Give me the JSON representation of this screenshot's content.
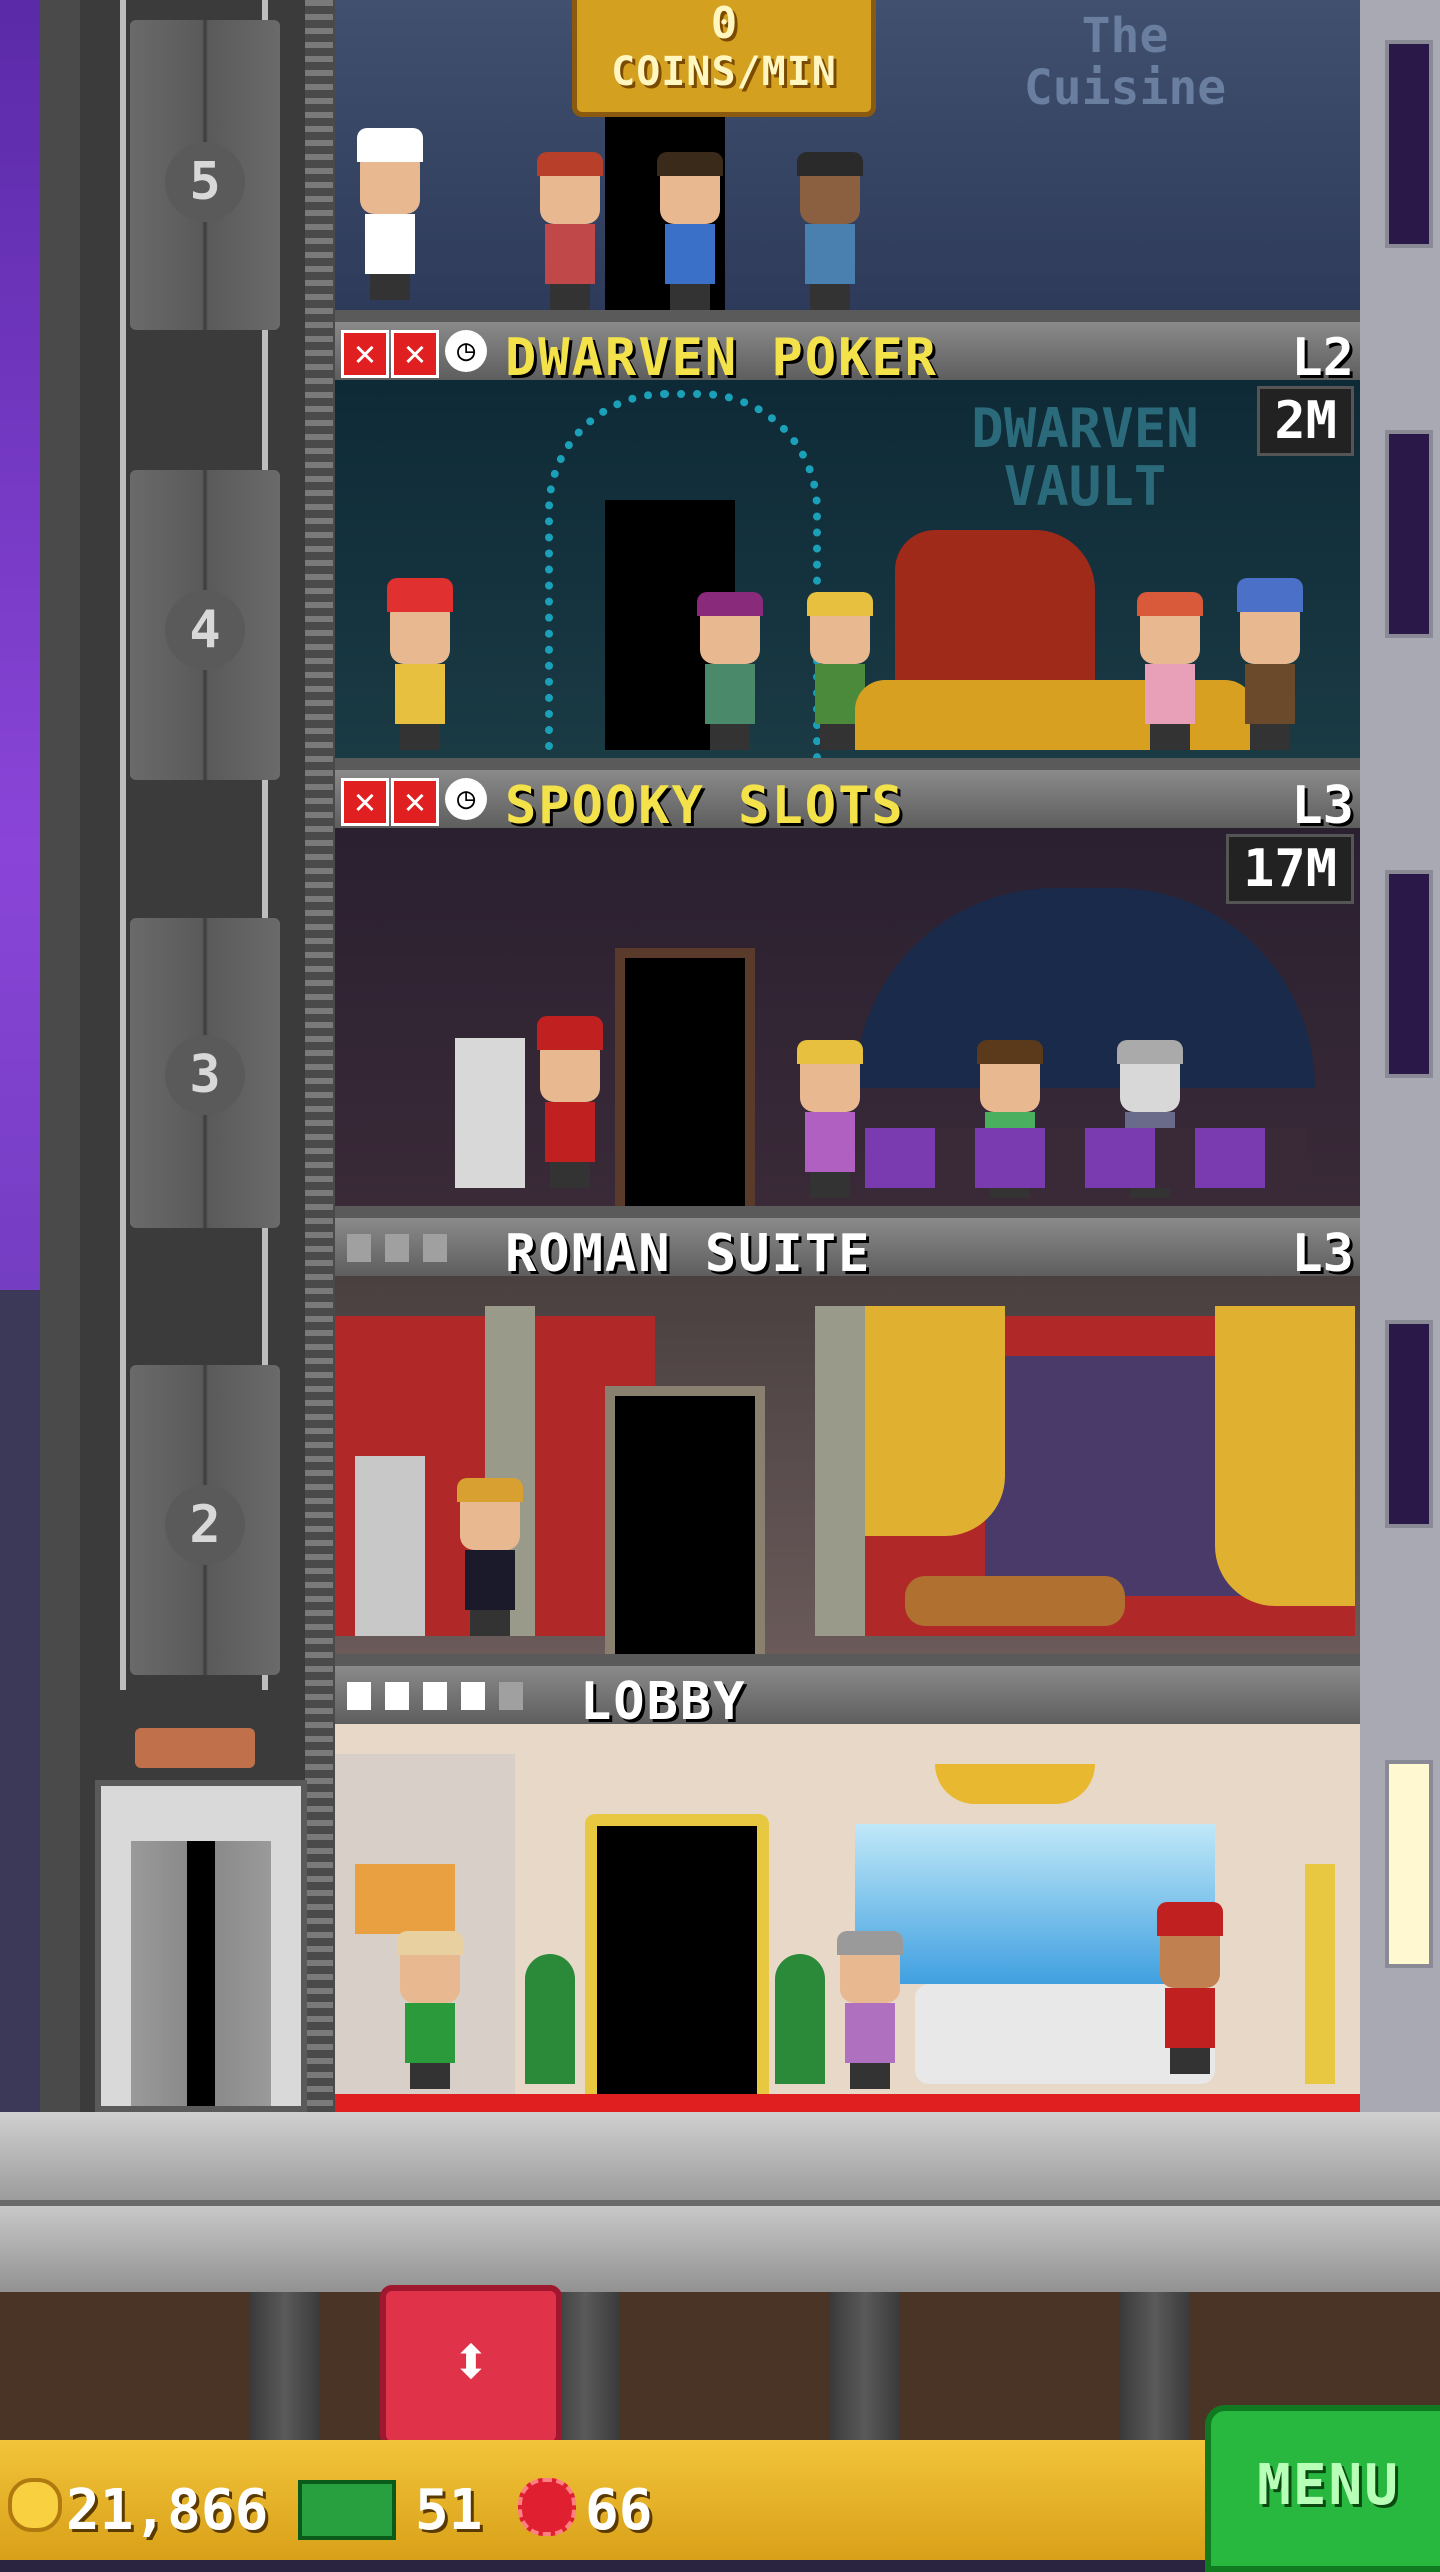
{
  "top": {
    "coins_per_min_value": "0",
    "coins_per_min_label": "COINS/MIN"
  },
  "shaft": {
    "floor_numbers": [
      "5",
      "4",
      "3",
      "2"
    ]
  },
  "floors": [
    {
      "name": "DWARVEN POKER",
      "level": "L2",
      "badge": "2M",
      "status": "stocking"
    },
    {
      "name": "SPOOKY SLOTS",
      "level": "L3",
      "badge": "17M",
      "status": "stocking"
    },
    {
      "name": "ROMAN SUITE",
      "level": "L3",
      "badge": "",
      "status": "residential"
    },
    {
      "name": "LOBBY",
      "level": "",
      "badge": "",
      "status": "lobby"
    }
  ],
  "restaurant_sign": {
    "line1": "The",
    "line2": "Cuisine"
  },
  "poker_sign": {
    "line1": "DWARVEN",
    "line2": "VAULT"
  },
  "bottom_bar": {
    "coins": "21,866",
    "tower_bux": "51",
    "gems": "66",
    "menu_label": "MENU"
  },
  "icons": {
    "elevator_button": "up-down-arrows-icon",
    "coin": "coin-icon",
    "bux": "tower-bux-icon",
    "gem": "gem-icon",
    "x": "x-icon",
    "clock": "clock-icon",
    "pawn": "resident-icon"
  },
  "colors": {
    "floor_title": "#f4e24a",
    "menu_green": "#28b840",
    "elevator_red": "#e0334a",
    "lobby_floor": "#e02020"
  }
}
